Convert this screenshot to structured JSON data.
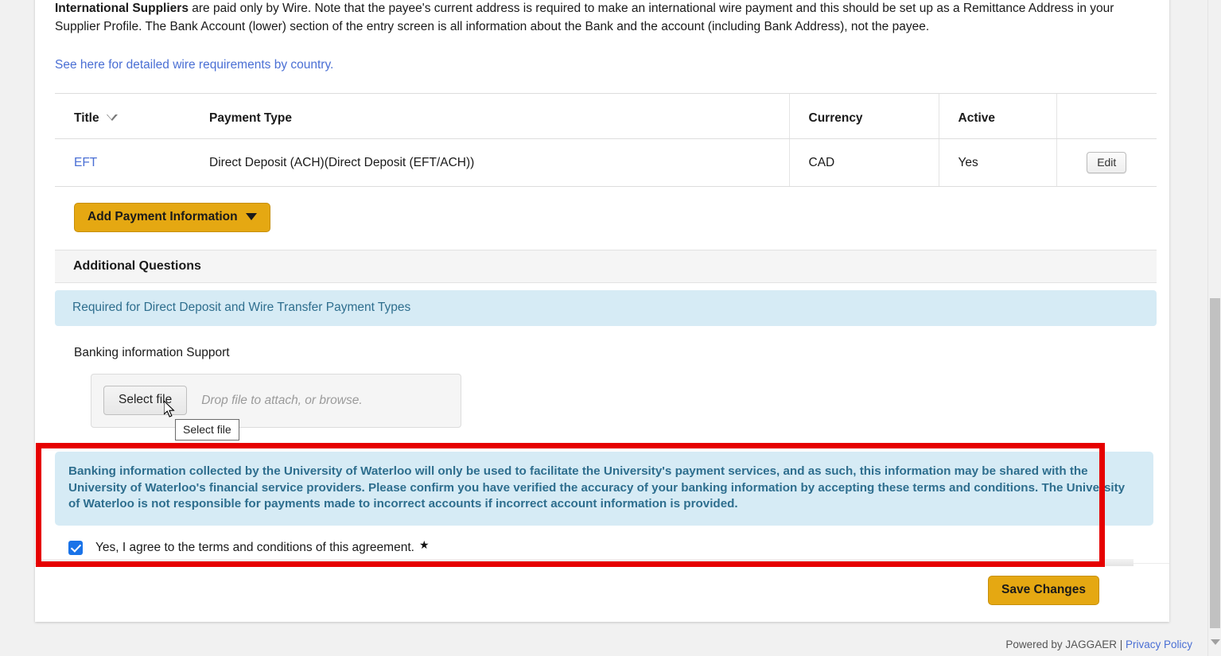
{
  "intro": {
    "bold_lead": "International Suppliers",
    "paragraph": " are paid only by Wire.  Note that the payee's current address is required to make an international wire payment and this should be set up as a Remittance Address in your Supplier Profile.  The Bank Account (lower) section of the entry screen is all information about the Bank and the account (including Bank Address), not the payee.",
    "link_text": "See here for detailed wire requirements by country."
  },
  "payment_table": {
    "columns": [
      "Title",
      "Payment Type",
      "Currency",
      "Active",
      ""
    ],
    "sort_icon": "sort-descending-icon",
    "rows": [
      {
        "title": "EFT",
        "payment_type": "Direct Deposit (ACH)(Direct Deposit (EFT/ACH))",
        "currency": "CAD",
        "active": "Yes",
        "edit_label": "Edit"
      }
    ]
  },
  "toolbar": {
    "add_payment_label": "Add Payment Information",
    "add_payment_caret_icon": "chevron-down-icon"
  },
  "additional_questions": {
    "section_title": "Additional Questions",
    "info_band": "Required for Direct Deposit and Wire Transfer Payment Types",
    "field_label": "Banking information Support",
    "upload": {
      "select_file_label": "Select file",
      "drop_hint": "Drop file to attach, or browse.",
      "tooltip": "Select file"
    }
  },
  "terms": {
    "body": "Banking information collected by the University of Waterloo will only be used to facilitate the University's payment services, and as such, this information may be shared with the University of Waterloo's financial service providers. Please confirm you have verified the accuracy of your banking information by accepting these terms and conditions. The University of Waterloo is not responsible for payments made to incorrect accounts if incorrect account information is provided.",
    "agree_label": "Yes, I agree to the terms and conditions of this agreement.",
    "required_marker": "★",
    "checkbox_checked": true,
    "highlight_color": "#e60000"
  },
  "footer": {
    "save_label": "Save Changes",
    "powered_by": "Powered by JAGGAER |",
    "privacy_policy": "Privacy Policy"
  },
  "colors": {
    "gold": "#e5a812",
    "info_blue_bg": "#d6ebf5",
    "info_blue_text": "#2e6e8e",
    "link_blue": "#4a6fd4",
    "highlight_red": "#e60000",
    "checkbox_blue": "#1a73e8"
  },
  "scrollbar": {
    "down_arrow_icon": "chevron-down-icon"
  }
}
